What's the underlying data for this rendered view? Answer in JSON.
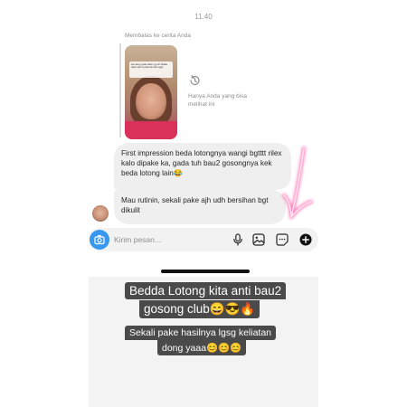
{
  "status_bar": {
    "time": "11.40"
  },
  "reply": {
    "label": "Membalas ke cerita Anda",
    "story_text": "kek ada yg pake sabun yg udh dipake sabun lain ini pake bau bau ngga"
  },
  "visibility_note": "Hanya Anda yang bisa melihat ini",
  "messages": [
    {
      "text": "First impression beda lotongnya wangi bgtttt rilex kalo dipake ka, gada tuh bau2 gosongnya kek beda lotong lain😂"
    },
    {
      "text": "Mau rutinin, sekali pake ajh udh bersihan bgt dikulit"
    }
  ],
  "composer": {
    "placeholder": "Kirim pesan..."
  },
  "icons": {
    "camera": "camera-icon",
    "history": "history-icon",
    "mic": "microphone-icon",
    "gallery": "gallery-icon",
    "sticker": "sticker-icon",
    "plus": "plus-icon"
  },
  "colors": {
    "accent": "#3897f0",
    "arrow": "#ff5fa8",
    "caption_bg": "#4a4a4a"
  },
  "caption": {
    "line1": "Bedda Lotong kita anti bau2",
    "line2": "gosong club😄😎🔥",
    "line3": "Sekali pake hasilnya lgsg keliatan",
    "line4": "dong yaaa😊😊😊"
  }
}
